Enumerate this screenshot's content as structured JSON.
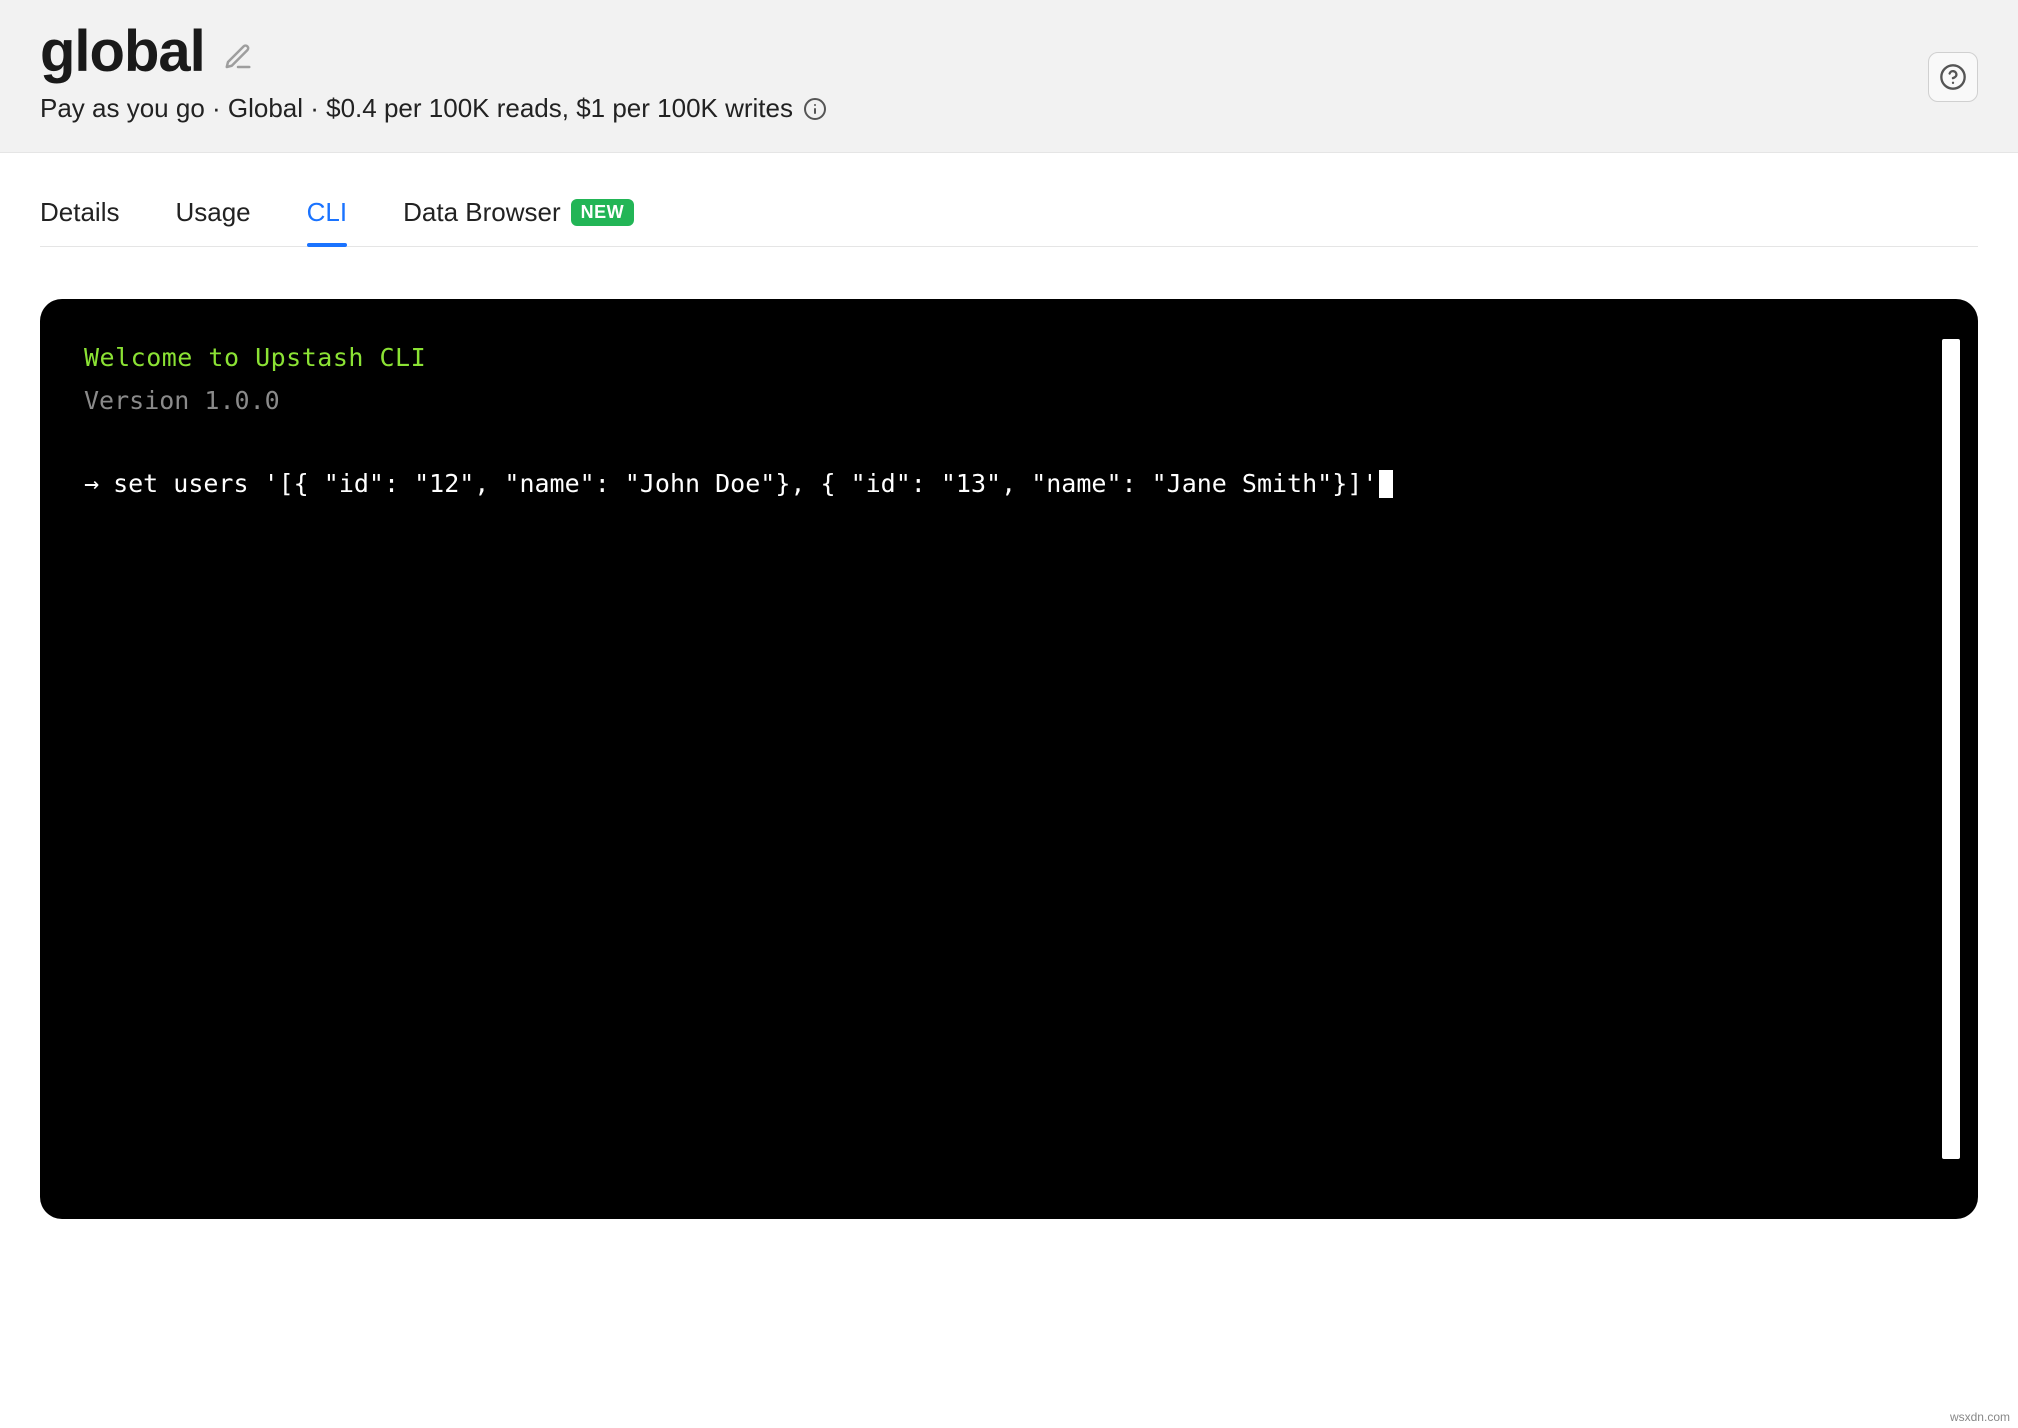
{
  "header": {
    "title": "global",
    "subtitle": "Pay as you go · Global · $0.4 per 100K reads, $1 per 100K writes"
  },
  "tabs": [
    {
      "label": "Details",
      "active": false
    },
    {
      "label": "Usage",
      "active": false
    },
    {
      "label": "CLI",
      "active": true
    },
    {
      "label": "Data Browser",
      "active": false,
      "badge": "NEW"
    }
  ],
  "terminal": {
    "welcome": "Welcome to Upstash CLI",
    "version": "Version 1.0.0",
    "prompt": "→",
    "command": "set users '[{ \"id\": \"12\", \"name\": \"John Doe\"}, { \"id\": \"13\", \"name\": \"Jane Smith\"}]'"
  },
  "watermark": "wsxdn.com"
}
